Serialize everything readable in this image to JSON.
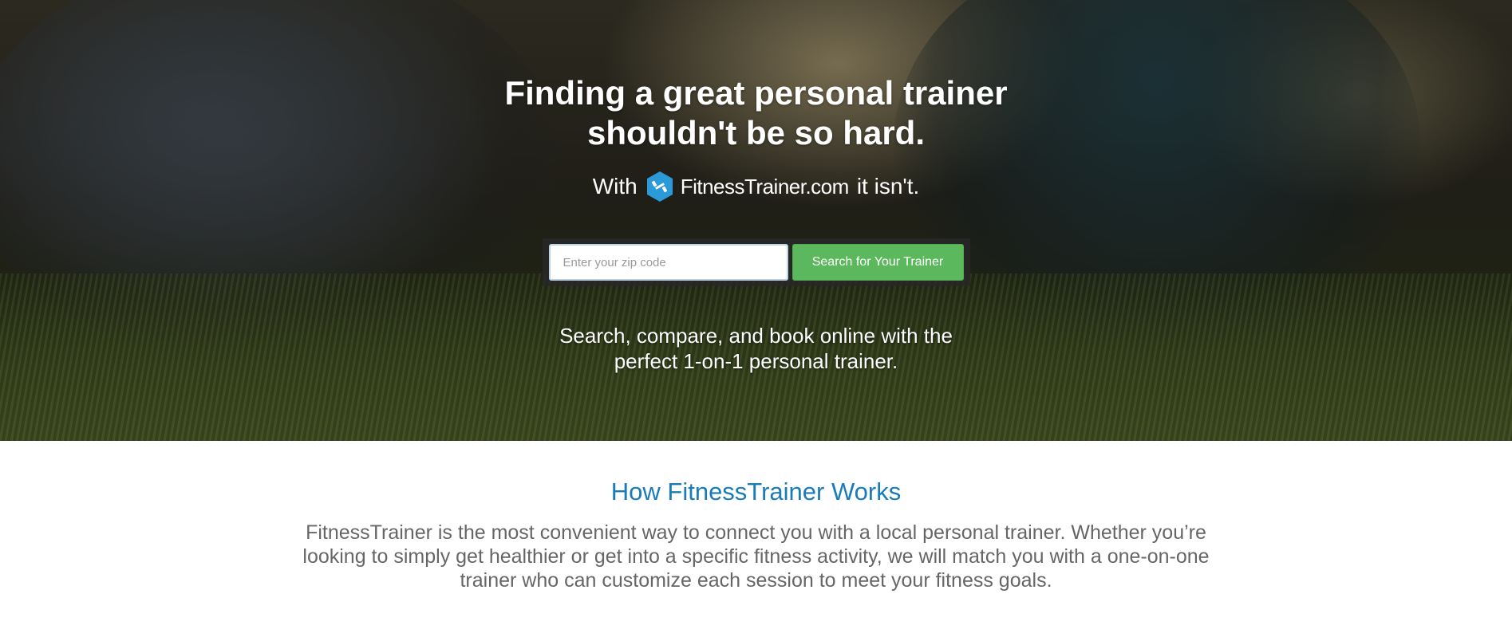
{
  "hero": {
    "headline_line1": "Finding a great personal trainer",
    "headline_line2": "shouldn't be so hard.",
    "tagline_prefix": "With",
    "logo_icon": "dumbbell-hexagon-icon",
    "logo_text": "FitnessTrainer.com",
    "tagline_suffix": "it isn't.",
    "search": {
      "placeholder": "Enter your zip code",
      "value": "",
      "button_label": "Search for Your Trainer"
    },
    "subline_line1": "Search, compare, and book online with the",
    "subline_line2": "perfect 1-on-1 personal trainer."
  },
  "how_it_works": {
    "title": "How FitnessTrainer Works",
    "body": "FitnessTrainer is the most convenient way to connect you with a local personal trainer. Whether you’re looking to simply get healthier or get into a specific fitness activity, we will match you with a one-on-one trainer who can customize each session to meet your fitness goals."
  },
  "colors": {
    "accent_blue": "#1a7bb9",
    "button_green": "#5cb85c",
    "logo_blue": "#2a9ad8"
  }
}
